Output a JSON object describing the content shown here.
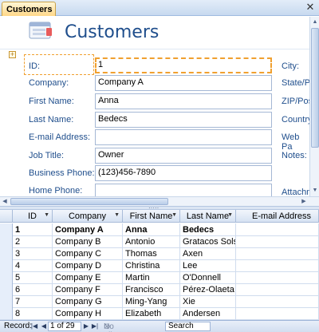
{
  "tab": {
    "label": "Customers"
  },
  "header": {
    "title": "Customers"
  },
  "form": {
    "left_fields": [
      {
        "label": "ID:",
        "value": "1"
      },
      {
        "label": "Company:",
        "value": "Company A"
      },
      {
        "label": "First Name:",
        "value": "Anna"
      },
      {
        "label": "Last Name:",
        "value": "Bedecs"
      },
      {
        "label": "E-mail Address:",
        "value": ""
      },
      {
        "label": "Job Title:",
        "value": "Owner"
      },
      {
        "label": "Business Phone:",
        "value": "(123)456-7890"
      },
      {
        "label": "Home Phone:",
        "value": ""
      }
    ],
    "right_labels": [
      "City:",
      "State/Pro",
      "ZIP/Pos",
      "Country",
      "Web Pa",
      "Notes:",
      "Attachm"
    ]
  },
  "datasheet": {
    "columns": [
      "ID",
      "Company",
      "First Name",
      "Last Name",
      "E-mail Address"
    ],
    "rows": [
      {
        "id": "1",
        "company": "Company A",
        "first": "Anna",
        "last": "Bedecs"
      },
      {
        "id": "2",
        "company": "Company B",
        "first": "Antonio",
        "last": "Gratacos Solso"
      },
      {
        "id": "3",
        "company": "Company C",
        "first": "Thomas",
        "last": "Axen"
      },
      {
        "id": "4",
        "company": "Company D",
        "first": "Christina",
        "last": "Lee"
      },
      {
        "id": "5",
        "company": "Company E",
        "first": "Martin",
        "last": "O'Donnell"
      },
      {
        "id": "6",
        "company": "Company F",
        "first": "Francisco",
        "last": "Pérez-Olaeta"
      },
      {
        "id": "7",
        "company": "Company G",
        "first": "Ming-Yang",
        "last": "Xie"
      },
      {
        "id": "8",
        "company": "Company H",
        "first": "Elizabeth",
        "last": "Andersen"
      }
    ]
  },
  "navigation": {
    "record_label": "Record:",
    "record_value": "1 of 29",
    "filter_label": "No Filter",
    "search_label": "Search"
  },
  "colors": {
    "accent": "#1f4e8c",
    "focus": "#f0a030",
    "tab": "#ffd889"
  }
}
